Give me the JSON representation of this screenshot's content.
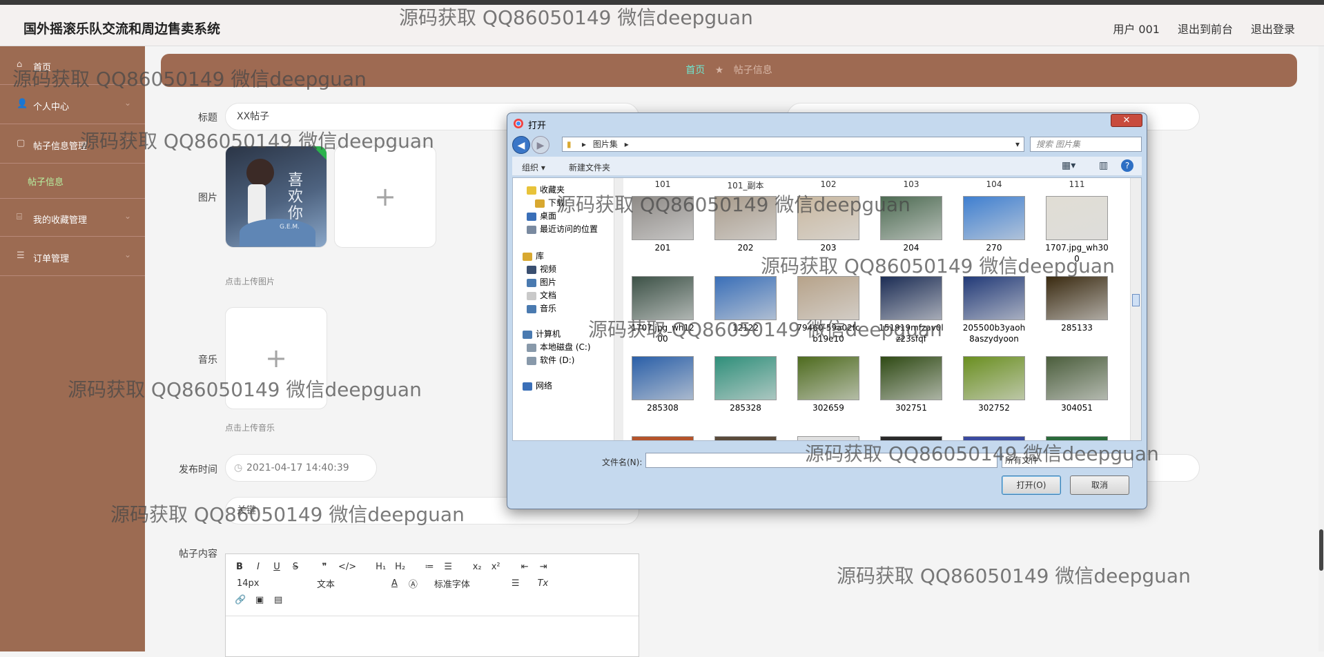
{
  "header": {
    "title": "国外摇滚乐队交流和周边售卖系统",
    "links": [
      "用户 001",
      "退出到前台",
      "退出登录"
    ]
  },
  "sidebar": {
    "items": [
      {
        "label": "首页",
        "icon": "home-icon"
      },
      {
        "label": "个人中心",
        "icon": "user-icon"
      },
      {
        "label": "帖子信息管理",
        "icon": "post-icon"
      },
      {
        "label": "我的收藏管理",
        "icon": "star-icon"
      },
      {
        "label": "订单管理",
        "icon": "order-icon"
      }
    ],
    "subitem": "帖子信息"
  },
  "breadcrumb": {
    "home": "首页",
    "current": "帖子信息"
  },
  "form": {
    "title_label": "标题",
    "title_value": "XX帖子",
    "image_label": "图片",
    "upload_image_hint": "点击上传图片",
    "music_label": "音乐",
    "upload_music_hint": "点击上传音乐",
    "publish_label": "发布时间",
    "publish_value": "2021-04-17 14:40:39",
    "tag_value": "关键",
    "content_label": "帖子内容",
    "album_title": "喜欢你",
    "album_artist": "G.E.M."
  },
  "editor": {
    "row1": [
      "B",
      "I",
      "U",
      "S",
      "❞",
      "</>",
      "H₁",
      "H₂",
      "≔",
      "☰",
      "x₂",
      "x²",
      "⇤",
      "⇥"
    ],
    "font_size": "14px",
    "text_type": "文本",
    "font_family": "标准字体",
    "clear": "Tx"
  },
  "dialog": {
    "title": "打开",
    "close": "✕",
    "path": [
      "图片集"
    ],
    "search_placeholder": "搜索 图片集",
    "toolbar": {
      "organize": "组织 ▾",
      "new_folder": "新建文件夹"
    },
    "tree": [
      "收藏夹",
      "下载",
      "桌面",
      "最近访问的位置",
      "库",
      "视频",
      "图片",
      "文档",
      "音乐",
      "计算机",
      "本地磁盘 (C:)",
      "软件 (D:)",
      "网络"
    ],
    "top_labels": [
      "101",
      "101_副本",
      "102",
      "103",
      "104",
      "111"
    ],
    "files": [
      {
        "name": "201",
        "color": "#8e8a86"
      },
      {
        "name": "202",
        "color": "#a99c8c"
      },
      {
        "name": "203",
        "color": "#c9b8a0"
      },
      {
        "name": "204",
        "color": "#4d6b52"
      },
      {
        "name": "270",
        "color": "#3f7fd0"
      },
      {
        "name": "1707.jpg_wh300",
        "color": "#e0ddd4"
      },
      {
        "name": "1707.jpg_wh1200",
        "color": "#3d5247"
      },
      {
        "name": "12122",
        "color": "#3a6fb8"
      },
      {
        "name": "79460-59a02fcb19e10",
        "color": "#b7a38a"
      },
      {
        "name": "151919mfzav0lz23sfqf",
        "color": "#1c2d55"
      },
      {
        "name": "205500b3yaoh8aszydyoon",
        "color": "#223a78"
      },
      {
        "name": "285133",
        "color": "#3a2a10"
      },
      {
        "name": "285308",
        "color": "#2a5fa8"
      },
      {
        "name": "285328",
        "color": "#2f8f7a"
      },
      {
        "name": "302659",
        "color": "#4e6b1e"
      },
      {
        "name": "302751",
        "color": "#2f4a14"
      },
      {
        "name": "302752",
        "color": "#6a8f20"
      },
      {
        "name": "304051",
        "color": "#4b5e3c"
      }
    ],
    "filename_label": "文件名(N):",
    "filetype": "所有文件",
    "open_button": "打开(O)",
    "cancel_button": "取消"
  },
  "watermark": "源码获取 QQ86050149 微信deepguan"
}
